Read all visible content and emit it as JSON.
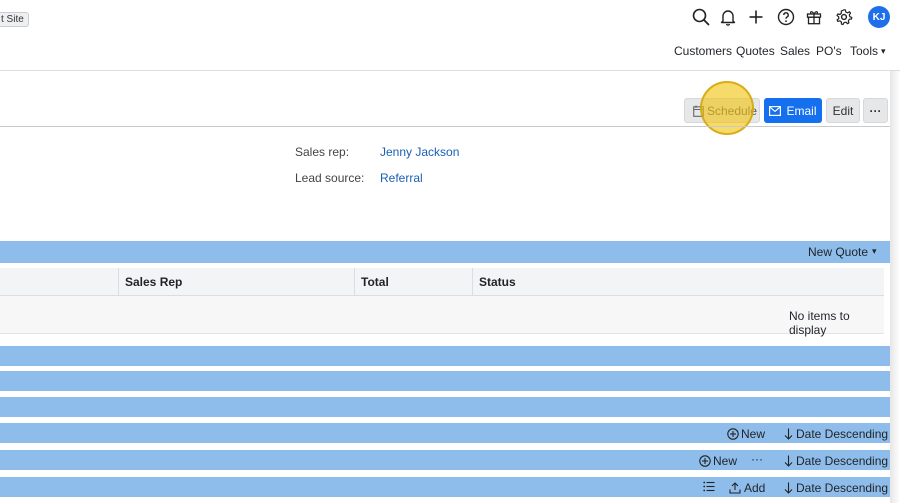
{
  "header": {
    "site_chip": "t Site",
    "avatar_initials": "KJ",
    "nav": [
      "Customers",
      "Quotes",
      "Sales",
      "PO's",
      "Tools"
    ],
    "tools_caret": "▾"
  },
  "toolbar": {
    "schedule_label": "Schedule",
    "email_label": "Email",
    "edit_label": "Edit",
    "more_label": "···"
  },
  "details": {
    "sales_rep_label": "Sales rep:",
    "sales_rep_value": "Jenny Jackson",
    "lead_source_label": "Lead source:",
    "lead_source_value": "Referral"
  },
  "quotes_panel": {
    "new_quote_label": "New Quote",
    "caret": "▾",
    "columns": [
      "Sales Rep",
      "Total",
      "Status"
    ],
    "empty_message": "No items to display"
  },
  "section_rows": [
    {
      "actions": []
    },
    {
      "actions": []
    },
    {
      "actions": []
    },
    {
      "new_label": "New",
      "sort_label": "Date Descending"
    },
    {
      "new_label": "New",
      "more_label": "···",
      "sort_label": "Date Descending"
    },
    {
      "add_label": "Add",
      "sort_label": "Date Descending"
    }
  ],
  "colors": {
    "accent_blue": "#1570ef",
    "band_blue": "#8fbdeb",
    "link_blue": "#1a5fb4",
    "highlight": "#f1c40f"
  }
}
